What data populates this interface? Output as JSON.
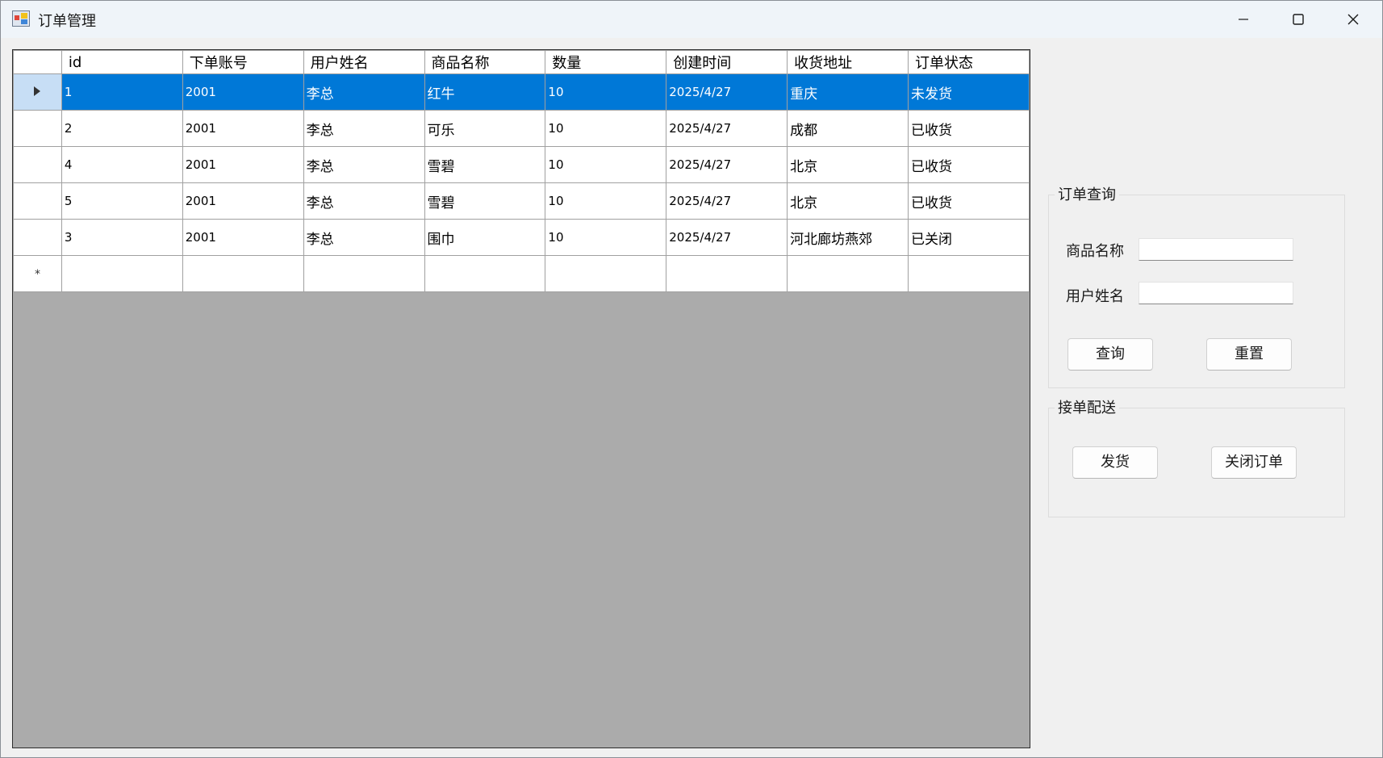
{
  "window": {
    "title": "订单管理"
  },
  "grid": {
    "columns": [
      "id",
      "下单账号",
      "用户姓名",
      "商品名称",
      "数量",
      "创建时间",
      "收货地址",
      "订单状态"
    ],
    "rows": [
      {
        "id": "1",
        "account": "2001",
        "user": "李总",
        "product": "红牛",
        "qty": "10",
        "created": "2025/4/27",
        "address": "重庆",
        "status": "未发货"
      },
      {
        "id": "2",
        "account": "2001",
        "user": "李总",
        "product": "可乐",
        "qty": "10",
        "created": "2025/4/27",
        "address": "成都",
        "status": "已收货"
      },
      {
        "id": "4",
        "account": "2001",
        "user": "李总",
        "product": "雪碧",
        "qty": "10",
        "created": "2025/4/27",
        "address": "北京",
        "status": "已收货"
      },
      {
        "id": "5",
        "account": "2001",
        "user": "李总",
        "product": "雪碧",
        "qty": "10",
        "created": "2025/4/27",
        "address": "北京",
        "status": "已收货"
      },
      {
        "id": "3",
        "account": "2001",
        "user": "李总",
        "product": "围巾",
        "qty": "10",
        "created": "2025/4/27",
        "address": "河北廊坊燕郊",
        "status": "已关闭"
      }
    ],
    "selected_row": 0,
    "new_row_marker": "*"
  },
  "query_group": {
    "title": "订单查询",
    "product_label": "商品名称",
    "product_value": "",
    "user_label": "用户姓名",
    "user_value": "",
    "query_button": "查询",
    "reset_button": "重置"
  },
  "delivery_group": {
    "title": "接单配送",
    "ship_button": "发货",
    "close_order_button": "关闭订单"
  },
  "colors": {
    "selection": "#0078d7",
    "row_header_selected": "#c7def5",
    "grid_background": "#ababab",
    "titlebar": "#eff4f9"
  }
}
